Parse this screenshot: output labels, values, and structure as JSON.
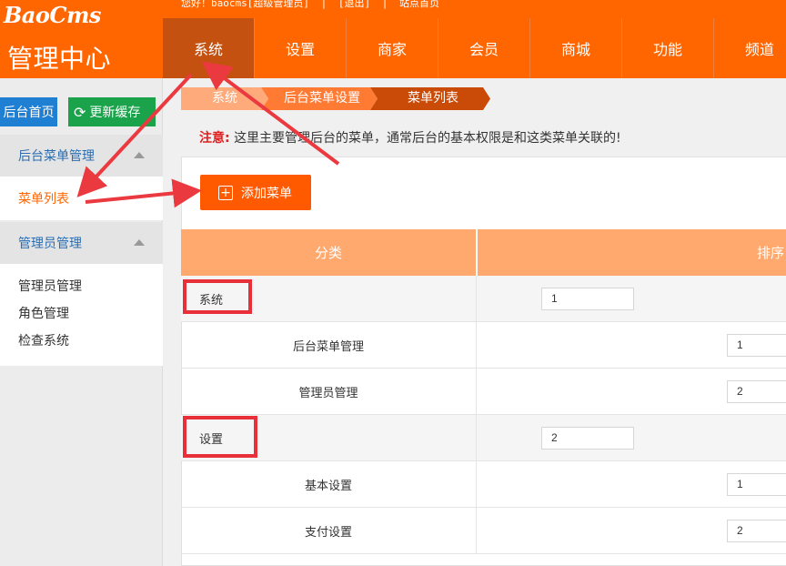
{
  "brand": {
    "logo": "BaoCms",
    "center": "管理中心"
  },
  "topbar": {
    "greeting": "您好！baocms[超级管理员]",
    "sep": "|",
    "logout": "[退出]",
    "site_home": "站点首页"
  },
  "nav": [
    "系统",
    "设置",
    "商家",
    "会员",
    "商城",
    "功能",
    "频道"
  ],
  "sidebar": {
    "home_button": "后台首页",
    "cache_button": "更新缓存",
    "sections": [
      {
        "title": "后台菜单管理",
        "items": [
          "菜单列表"
        ]
      },
      {
        "title": "管理员管理",
        "items": [
          "管理员管理",
          "角色管理",
          "检查系统"
        ]
      }
    ]
  },
  "breadcrumb": [
    "系统",
    "后台菜单设置",
    "菜单列表"
  ],
  "notice": {
    "label": "注意:",
    "text": "这里主要管理后台的菜单，通常后台的基本权限是和这类菜单关联的!"
  },
  "add_button": "添加菜单",
  "table": {
    "headers": [
      "分类",
      "排序"
    ],
    "rows": [
      {
        "name": "系统",
        "sort": "1",
        "type": "group"
      },
      {
        "name": "后台菜单管理",
        "sort": "1",
        "type": "child"
      },
      {
        "name": "管理员管理",
        "sort": "2",
        "type": "child"
      },
      {
        "name": "设置",
        "sort": "2",
        "type": "group"
      },
      {
        "name": "基本设置",
        "sort": "1",
        "type": "child"
      },
      {
        "name": "支付设置",
        "sort": "2",
        "type": "child"
      }
    ]
  },
  "colors": {
    "brand": "#ff6600",
    "active_nav": "#c55110",
    "highlight": "#e8303a",
    "link": "#2a6db0"
  }
}
